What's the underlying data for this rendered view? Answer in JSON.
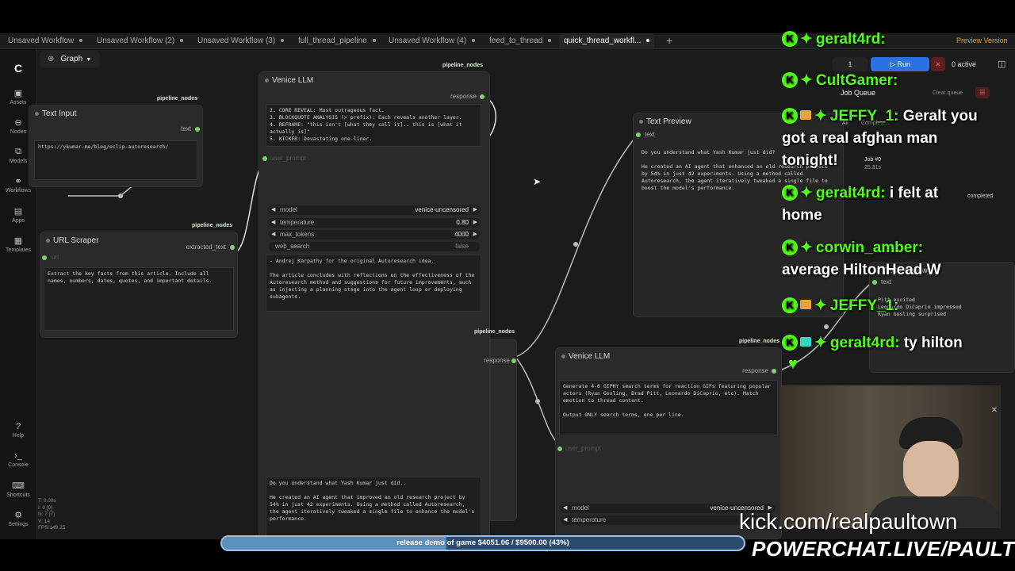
{
  "tabs": [
    {
      "label": "Unsaved Workflow"
    },
    {
      "label": "Unsaved Workflow (2)"
    },
    {
      "label": "Unsaved Workflow (3)"
    },
    {
      "label": "full_thread_pipeline"
    },
    {
      "label": "Unsaved Workflow (4)"
    },
    {
      "label": "feed_to_thread"
    },
    {
      "label": "quick_thread_workfl..."
    }
  ],
  "preview_version": "Preview Version",
  "view_selector": "Graph",
  "sidebar": [
    {
      "label": "Assets",
      "icon": "assets-icon"
    },
    {
      "label": "Nodes",
      "icon": "nodes-icon"
    },
    {
      "label": "Models",
      "icon": "models-icon"
    },
    {
      "label": "Workflows",
      "icon": "workflows-icon"
    },
    {
      "label": "Apps",
      "icon": "apps-icon"
    },
    {
      "label": "Templates",
      "icon": "templates-icon"
    },
    {
      "label": "Help",
      "icon": "help-icon"
    },
    {
      "label": "Console",
      "icon": "console-icon"
    },
    {
      "label": "Shortcuts",
      "icon": "shortcuts-icon"
    },
    {
      "label": "Settings",
      "icon": "settings-icon"
    }
  ],
  "stats": [
    "T: 0.00s",
    "I: 0 [0]",
    "N: 7 [7]",
    "V: 14",
    "FPS:149.25"
  ],
  "controls": {
    "run_count": "1",
    "run": "Run",
    "active": "0 active"
  },
  "queue": {
    "title": "Job Queue",
    "clear": "Clear queue",
    "all": "All",
    "completed_tab": "Complete...",
    "job": "Job #0",
    "time": "25.31s",
    "status": "completed"
  },
  "nodes": {
    "text_input": {
      "title": "Text Input",
      "tag": "pipeline_nodes",
      "out": "text",
      "value": "https://ykumar.me/blog/eclip-autoresearch/"
    },
    "url_scraper": {
      "title": "URL Scraper",
      "tag": "pipeline_nodes",
      "in": "url",
      "out": "extracted_text",
      "value": "Extract the key facts from this article. Include all names, numbers, dates, quotes, and important details."
    },
    "venice1": {
      "title": "Venice LLM",
      "tag": "pipeline_nodes",
      "out": "response",
      "in": "user_prompt",
      "system_prompt": "2. CORE REVEAL: Most outrageous fact.\n3. BLOCKQUOTE ANALYSIS (> prefix): Each reveals another layer.\n4. REFRAME: \"this isn't [what they call it].. this is [what it actually is]\"\n5. KICKER: Devastating one-liner.\n\nSTYLE: Use .. for pauses. Short sentences. No hashtags. 150-350 words.",
      "model_label": "model",
      "model": "venice-uncensored",
      "temp_label": "temperature",
      "temp": "0.80",
      "max_label": "max_tokens",
      "max": "4000",
      "web_label": "web_search",
      "web": "false",
      "output1": "- Andrej Karpathy for the original Autoresearch idea.\n\nThe article concludes with reflections on the effectiveness of the Autoresearch method and suggestions for future improvements, such as injecting a planning stage into the agent loop or deploying subagents.",
      "output2": "Do you understand what Yash Kumar just did..\n\nHe created an AI agent that improved an old research project by 54% in just 42 experiments. Using a method called Autoresearch, the agent iteratively tweaked a single file to enhance the model's performance."
    },
    "text_preview": {
      "title": "Text Preview",
      "in": "text",
      "value": "Do you understand what Yash Kumar just did?\n\nHe created an AI agent that enhanced an old research project by 54% in just 42 experiments. Using a method called Autoresearch, the agent iteratively tweaked a single file to boost the model's performance."
    },
    "venice2": {
      "title": "Venice LLM",
      "tag": "pipeline_nodes",
      "out": "response",
      "in": "user_prompt",
      "system_prompt": "Generate 4-6 GIPHY search terms for reaction GIFs featuring popular actors (Ryan Gosling, Brad Pitt, Leonardo DiCaprio, etc). Match emotion to thread content.\n\nOutput ONLY search terms, one per line.",
      "model_label": "model",
      "model": "venice-uncensored",
      "temp_label": "temperature"
    },
    "text_preview2": {
      "title": "Text Preview",
      "in": "text",
      "value": "Pitt excited\nLeonardo DiCaprio impressed\nRyan Gosling surprised"
    },
    "hidden_tag": "pipeline_nodes",
    "hidden_port": "response"
  },
  "chat": [
    {
      "user": "geralt4rd:",
      "msg": "",
      "badges": [
        "k",
        "s"
      ]
    },
    {
      "user": "CultGamer:",
      "msg": "",
      "badges": [
        "k",
        "s"
      ]
    },
    {
      "user": "JEFFY_1:",
      "msg": "Geralt you",
      "badges": [
        "k",
        "g",
        "s"
      ]
    },
    {
      "user": "",
      "msg": "got a real afghan man",
      "badges": []
    },
    {
      "user": "",
      "msg": "tonight!",
      "badges": []
    },
    {
      "user": "geralt4rd:",
      "msg": "i felt at",
      "badges": [
        "k",
        "s"
      ]
    },
    {
      "user": "",
      "msg": "home",
      "badges": []
    },
    {
      "user": "corwin_amber:",
      "msg": "",
      "badges": [
        "k",
        "s"
      ]
    },
    {
      "user": "",
      "msg": "average HiltonHead W",
      "badges": []
    },
    {
      "user": "JEFFY_1:",
      "msg": "",
      "badges": [
        "k",
        "g",
        "s"
      ]
    },
    {
      "user": "geralt4rd:",
      "msg": "ty hilton",
      "badges": [
        "k",
        "t",
        "s"
      ]
    }
  ],
  "overlay": {
    "progress_text": "release demo of game $4051.06 / $9500.00 (43%)",
    "progress": 0.43,
    "kick": "kick.com/realpaultown",
    "powerchat": "POWERCHAT.LIVE/PAULTOWN"
  },
  "colors": {
    "kick_green": "#53fc18",
    "run_blue": "#2a72e0",
    "port_green": "#7ad36b"
  }
}
